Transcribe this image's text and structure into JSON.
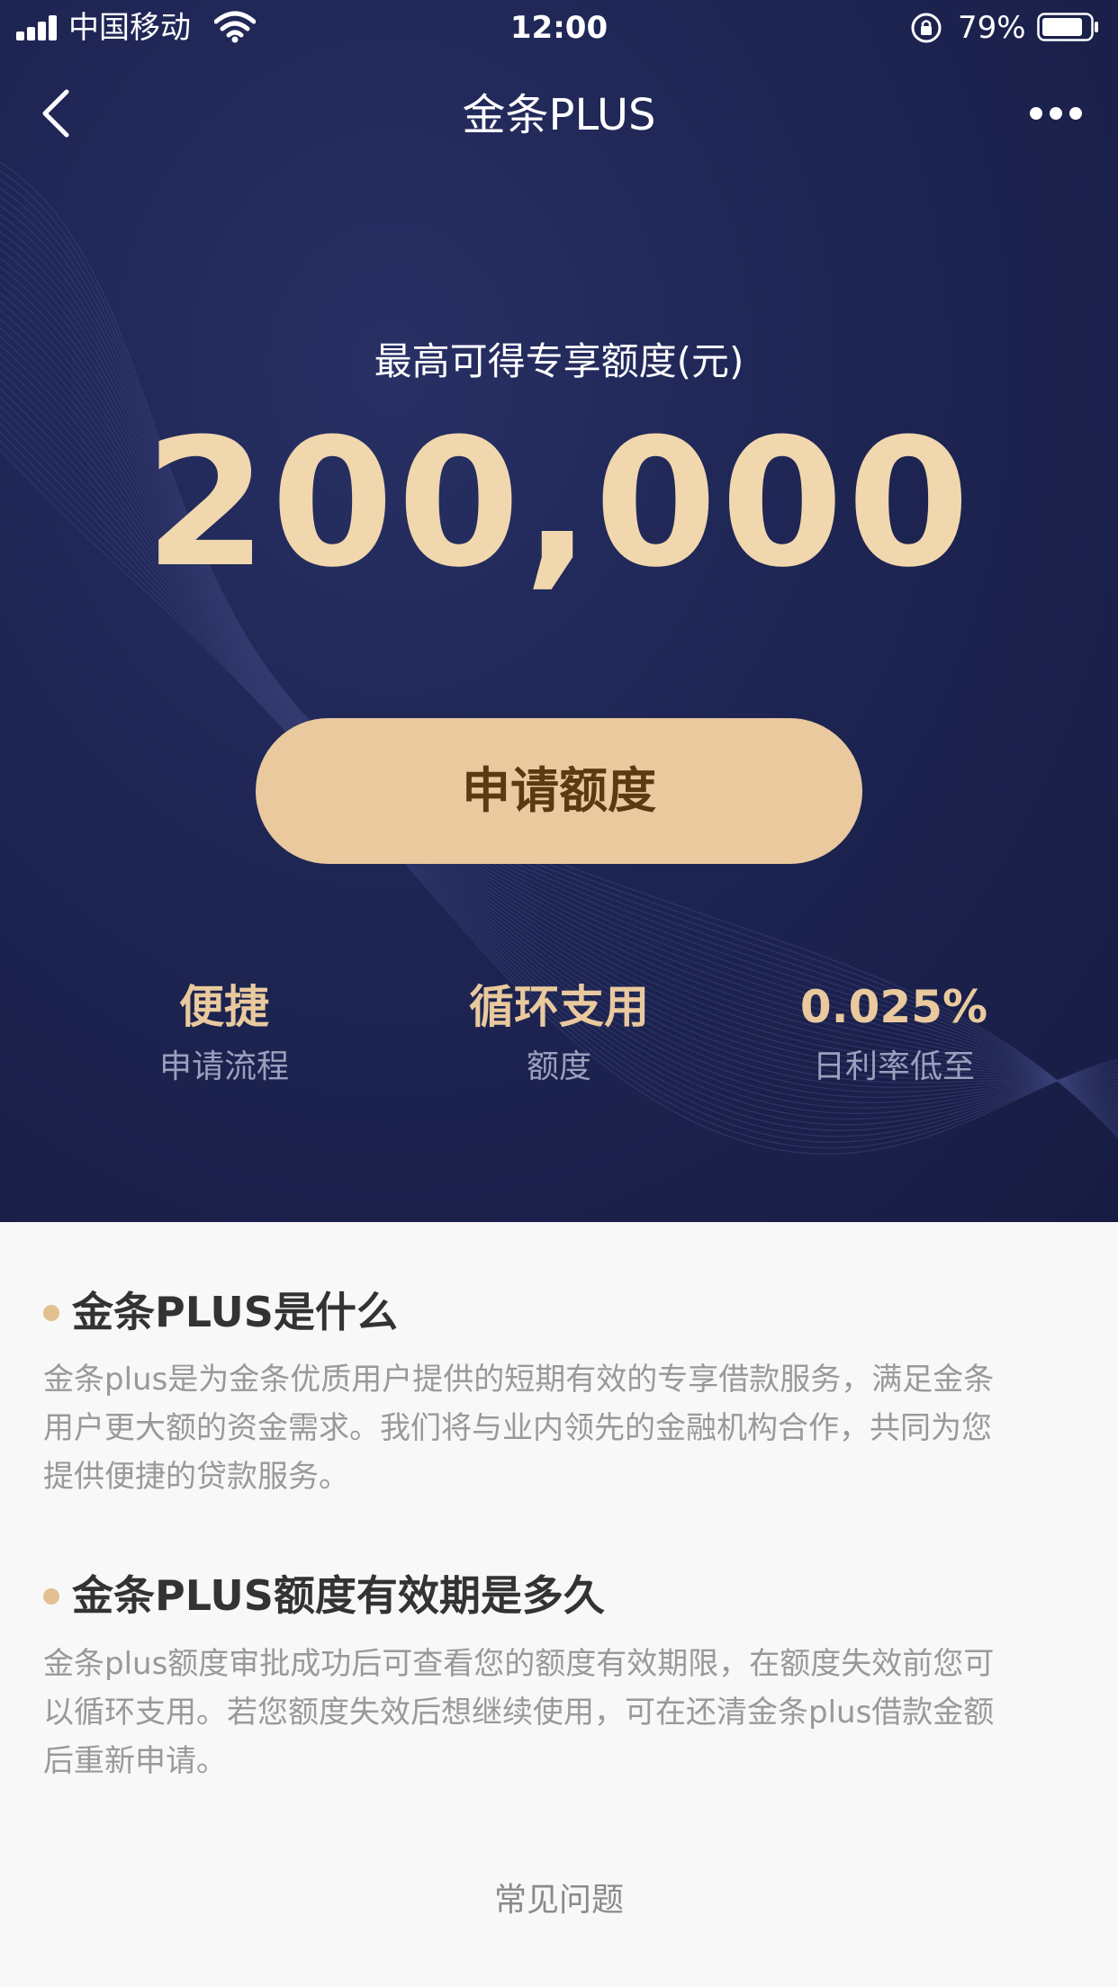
{
  "status_bar": {
    "carrier": "中国移动",
    "time": "12:00",
    "battery": "79%"
  },
  "nav": {
    "title": "金条PLUS"
  },
  "hero": {
    "limit_label": "最高可得专享额度(元)",
    "limit_amount": "200,000",
    "apply_button": "申请额度",
    "features": [
      {
        "value": "便捷",
        "label": "申请流程"
      },
      {
        "value": "循环支用",
        "label": "额度"
      },
      {
        "value": "0.025%",
        "label": "日利率低至"
      }
    ]
  },
  "faq": [
    {
      "title": "金条PLUS是什么",
      "lines": [
        "金条plus是为金条优质用户提供的短期有效的专享借款服务，满足金条",
        "用户更大额的资金需求。我们将与业内领先的金融机构合作，共同为您",
        "提供便捷的贷款服务。"
      ]
    },
    {
      "title": "金条PLUS额度有效期是多久",
      "lines": [
        "金条plus额度审批成功后可查看您的额度有效期限，在额度失效前您可",
        "以循环支用。若您额度失效后想继续使用，可在还清金条plus借款金额",
        "后重新申请。"
      ]
    }
  ],
  "faq_link": "常见问题",
  "colors": {
    "hero_bg": "#1e2553",
    "gold": "#e9c99d",
    "amount": "#f0d7ad",
    "button_text": "#5a3a12"
  },
  "icons": [
    "signal-icon",
    "wifi-icon",
    "rotation-lock-icon",
    "battery-icon",
    "back-arrow-icon",
    "more-icon"
  ]
}
